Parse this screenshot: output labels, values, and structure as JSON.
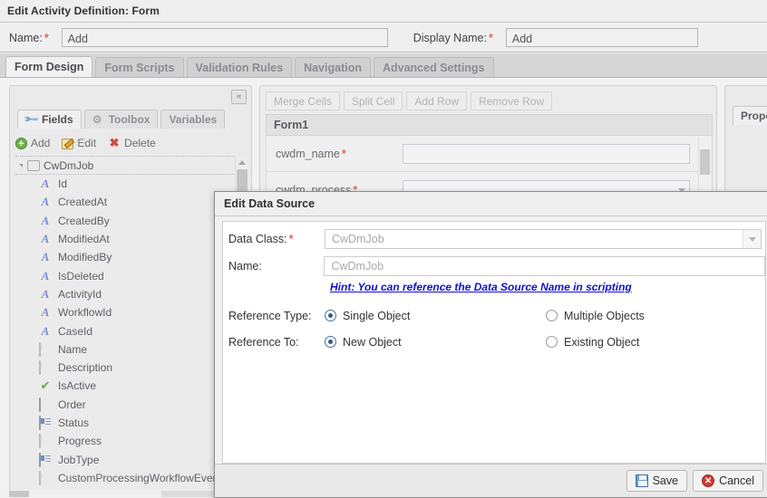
{
  "window": {
    "title": "Edit Activity Definition: Form"
  },
  "header": {
    "name_label": "Name:",
    "name_required": "*",
    "name_value": "Add",
    "display_name_label": "Display Name:",
    "display_name_required": "*",
    "display_name_value": "Add"
  },
  "tabs": [
    {
      "label": "Form Design",
      "active": true
    },
    {
      "label": "Form Scripts",
      "active": false
    },
    {
      "label": "Validation Rules",
      "active": false
    },
    {
      "label": "Navigation",
      "active": false
    },
    {
      "label": "Advanced Settings",
      "active": false
    }
  ],
  "left_panel": {
    "collapse_label": "«",
    "mini_tabs": [
      {
        "label": "Fields",
        "icon": "wrench-icon",
        "active": true
      },
      {
        "label": "Toolbox",
        "icon": "gear-icon",
        "active": false
      },
      {
        "label": "Variables",
        "icon": "",
        "active": false
      }
    ],
    "toolbar": [
      {
        "label": "Add",
        "icon": "plus-circle-icon"
      },
      {
        "label": "Edit",
        "icon": "pencil-icon"
      },
      {
        "label": "Delete",
        "icon": "delete-x-icon"
      }
    ],
    "tree_root": {
      "label": "CwDmJob",
      "icon": "object-icon"
    },
    "tree_items": [
      {
        "label": "Id",
        "icon": "string-icon"
      },
      {
        "label": "CreatedAt",
        "icon": "string-icon"
      },
      {
        "label": "CreatedBy",
        "icon": "string-icon"
      },
      {
        "label": "ModifiedAt",
        "icon": "string-icon"
      },
      {
        "label": "ModifiedBy",
        "icon": "string-icon"
      },
      {
        "label": "IsDeleted",
        "icon": "string-icon"
      },
      {
        "label": "ActivityId",
        "icon": "string-icon"
      },
      {
        "label": "WorkflowId",
        "icon": "string-icon"
      },
      {
        "label": "CaseId",
        "icon": "string-icon"
      },
      {
        "label": "Name",
        "icon": "textbox-icon"
      },
      {
        "label": "Description",
        "icon": "textbox-icon"
      },
      {
        "label": "IsActive",
        "icon": "checkmark-icon"
      },
      {
        "label": "Order",
        "icon": "numeric-icon"
      },
      {
        "label": "Status",
        "icon": "dropdown-list-icon"
      },
      {
        "label": "Progress",
        "icon": "textbox-icon"
      },
      {
        "label": "JobType",
        "icon": "dropdown-list-icon"
      },
      {
        "label": "CustomProcessingWorkflowEvent",
        "icon": "textbox-icon"
      }
    ]
  },
  "center_panel": {
    "toolbar": [
      {
        "label": "Merge Cells"
      },
      {
        "label": "Split Cell"
      },
      {
        "label": "Add Row"
      },
      {
        "label": "Remove Row"
      }
    ],
    "form_title": "Form1",
    "rows": [
      {
        "label": "cwdm_name",
        "required": "*",
        "control": "text"
      },
      {
        "label": "cwdm_process",
        "required": "*",
        "control": "select"
      }
    ]
  },
  "right_panel": {
    "tab_label": "Properties"
  },
  "dialog": {
    "title": "Edit Data Source",
    "data_class_label": "Data Class:",
    "data_class_required": "*",
    "data_class_value": "CwDmJob",
    "name_label": "Name:",
    "name_value": "CwDmJob",
    "hint": "Hint: You can reference the Data Source Name in scripting",
    "reference_type_label": "Reference Type:",
    "reference_type_options": [
      {
        "label": "Single Object",
        "selected": true
      },
      {
        "label": "Multiple Objects",
        "selected": false
      }
    ],
    "reference_to_label": "Reference To:",
    "reference_to_options": [
      {
        "label": "New Object",
        "selected": true
      },
      {
        "label": "Existing Object",
        "selected": false
      }
    ],
    "save_label": "Save",
    "cancel_label": "Cancel"
  },
  "colors": {
    "accent": "#2c5d8f",
    "required": "#e06666",
    "hint_link": "#1111cc",
    "cancel": "#cf3b33",
    "add": "#6fb04a"
  }
}
